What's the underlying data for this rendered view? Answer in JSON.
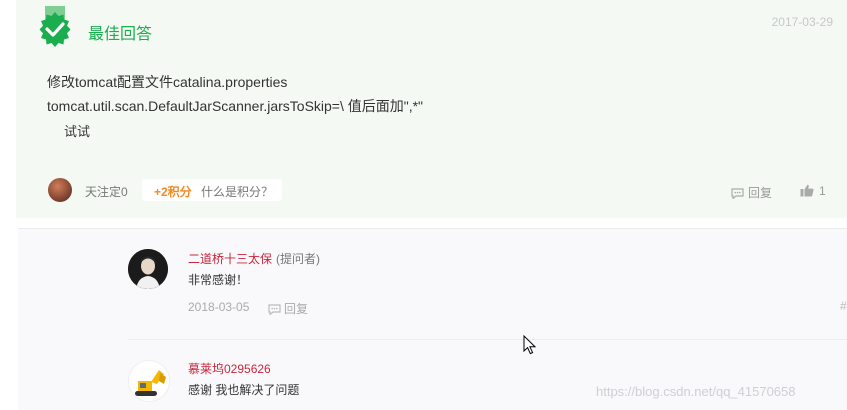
{
  "best_answer": {
    "title": "最佳回答",
    "date": "2017-03-29",
    "lines": [
      "修改tomcat配置文件catalina.properties",
      "tomcat.util.scan.DefaultJarScanner.jarsToSkip=\\ 值后面加\",*\"",
      "试试"
    ],
    "follow_label": "天注定0",
    "points_label": "+2积分",
    "points_help": "什么是积分？",
    "reply_label": "回复",
    "like_count": "1"
  },
  "comments": [
    {
      "author": "二道桥十三太保",
      "role": "(提问者)",
      "text": "非常感谢！",
      "date": "2018-03-05",
      "reply_label": "回复",
      "hash": "#"
    },
    {
      "author": "慕莱坞0295626",
      "text": "感谢 我也解决了问题"
    }
  ],
  "watermark": "https://blog.csdn.net/qq_41570658",
  "colors": {
    "accent_green": "#1aae4f",
    "author_red": "#c9253b",
    "points_orange": "#f08a24"
  },
  "icons": [
    "best-answer-badge-icon",
    "comment-icon",
    "thumbs-up-icon",
    "cursor-icon"
  ]
}
